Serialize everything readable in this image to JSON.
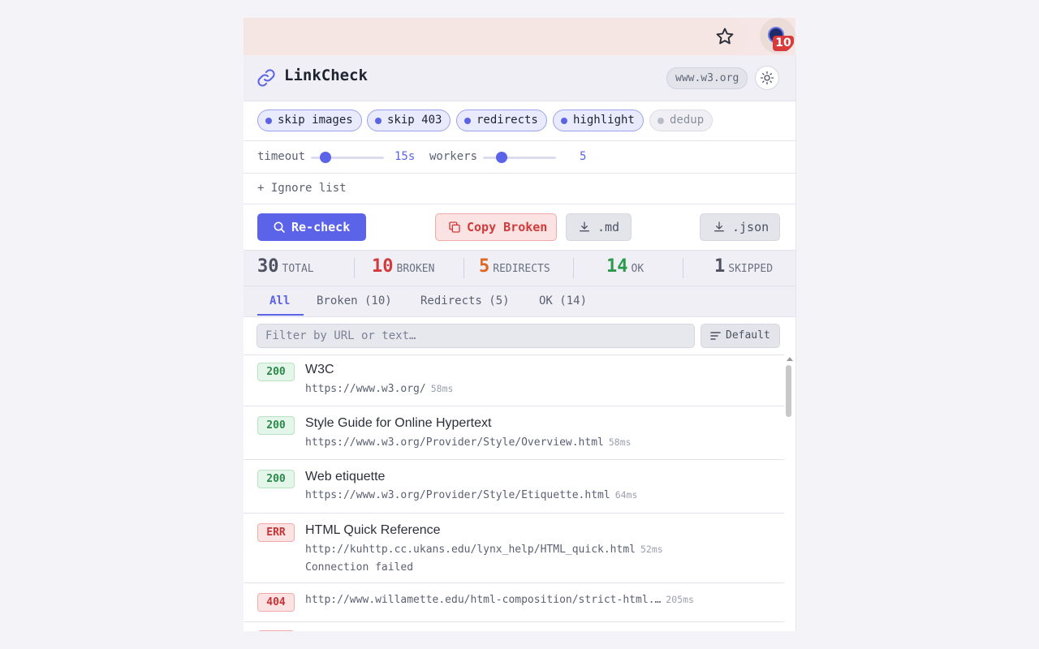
{
  "app": {
    "title": "LinkCheck",
    "domain": "www.w3.org",
    "badge": "10"
  },
  "chips": [
    {
      "label": "skip images",
      "on": true
    },
    {
      "label": "skip 403",
      "on": true
    },
    {
      "label": "redirects",
      "on": true
    },
    {
      "label": "highlight",
      "on": true
    },
    {
      "label": "dedup",
      "on": false
    }
  ],
  "sliders": {
    "timeout": {
      "label": "timeout",
      "value": "15s",
      "level": 0.2
    },
    "workers": {
      "label": "workers",
      "value": "5",
      "level": 0.25
    }
  },
  "ignore_list": {
    "label": "+ Ignore list"
  },
  "actions": {
    "recheck": "Re-check",
    "copy_broken": "Copy Broken",
    "export_md": ".md",
    "export_json": ".json"
  },
  "stats": {
    "total": {
      "num": "30",
      "label": "TOTAL"
    },
    "broken": {
      "num": "10",
      "label": "BROKEN"
    },
    "redirects": {
      "num": "5",
      "label": "REDIRECTS"
    },
    "ok": {
      "num": "14",
      "label": "OK"
    },
    "skipped": {
      "num": "1",
      "label": "SKIPPED"
    }
  },
  "tabs": [
    "All",
    "Broken (10)",
    "Redirects (5)",
    "OK (14)"
  ],
  "filter": {
    "placeholder": "Filter by URL or text…",
    "value": ""
  },
  "sort": {
    "label": "Default"
  },
  "results": [
    {
      "status": "200",
      "title": "W3C",
      "url": "https://www.w3.org/",
      "time": "58ms"
    },
    {
      "status": "200",
      "title": "Style Guide for Online Hypertext",
      "url": "https://www.w3.org/Provider/Style/Overview.html",
      "time": "58ms"
    },
    {
      "status": "200",
      "title": "Web etiquette",
      "url": "https://www.w3.org/Provider/Style/Etiquette.html",
      "time": "64ms"
    },
    {
      "status": "ERR",
      "title": "HTML Quick Reference",
      "url": "http://kuhttp.cc.ukans.edu/lynx_help/HTML_quick.html",
      "time": "52ms",
      "error": "Connection failed"
    },
    {
      "status": "404",
      "title": "",
      "url": "http://www.willamette.edu/html-composition/strict-html.…",
      "time": "205ms"
    }
  ],
  "colors": {
    "accent": "#5b63e8",
    "broken": "#d33a3a",
    "redirect": "#e0661f",
    "ok": "#2a9a4a",
    "skipped": "#4d5262"
  }
}
